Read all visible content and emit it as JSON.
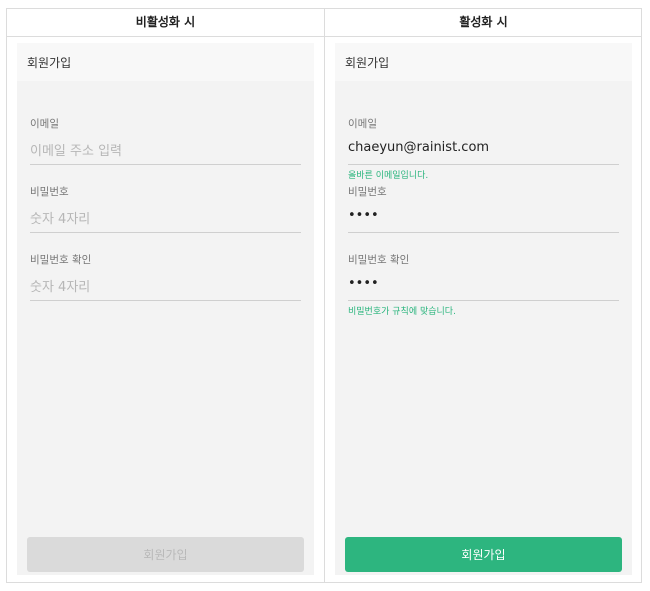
{
  "columns": {
    "inactive_title": "비활성화 시",
    "active_title": "활성화 시"
  },
  "inactive": {
    "screen_title": "회원가입",
    "email_label": "이메일",
    "email_placeholder": "이메일 주소 입력",
    "password_label": "비밀번호",
    "password_placeholder": "숫자 4자리",
    "confirm_label": "비밀번호 확인",
    "confirm_placeholder": "숫자 4자리",
    "submit_label": "회원가입"
  },
  "active": {
    "screen_title": "회원가입",
    "email_label": "이메일",
    "email_value": "chaeyun@rainist.com",
    "email_helper": "올바른 이메일입니다.",
    "password_label": "비밀번호",
    "password_value": "••••",
    "confirm_label": "비밀번호 확인",
    "confirm_value": "••••",
    "confirm_helper": "비밀번호가 규칙에 맞습니다.",
    "submit_label": "회원가입"
  },
  "colors": {
    "accent": "#2db57f",
    "helper_text": "#2bb57e",
    "disabled_button": "#dadada"
  }
}
